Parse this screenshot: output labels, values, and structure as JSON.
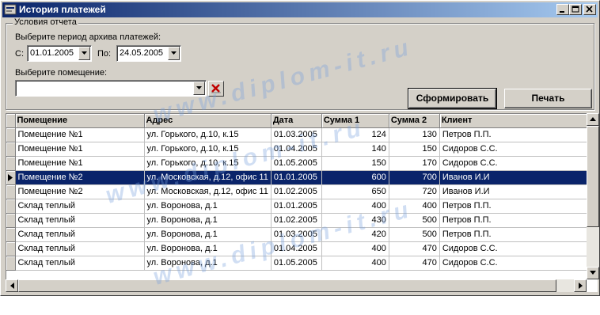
{
  "window": {
    "title": "История платежей"
  },
  "conditions": {
    "legend": "Условия отчета",
    "period_label": "Выберите период архива платежей:",
    "from_label": "С:",
    "from_value": "01.01.2005",
    "to_label": "По:",
    "to_value": "24.05.2005",
    "room_label": "Выберите помещение:",
    "room_value": ""
  },
  "actions": {
    "generate_label": "Сформировать",
    "print_label": "Печать"
  },
  "table": {
    "columns": [
      "Помещение",
      "Адрес",
      "Дата",
      "Сумма 1",
      "Сумма 2",
      "Клиент"
    ],
    "selected_row": 3,
    "rows": [
      [
        "Помещение №1",
        "ул. Горького, д.10, к.15",
        "01.03.2005",
        "124",
        "130",
        "Петров П.П."
      ],
      [
        "Помещение №1",
        "ул. Горького, д.10, к.15",
        "01.04.2005",
        "140",
        "150",
        "Сидоров С.С."
      ],
      [
        "Помещение №1",
        "ул. Горького, д.10, к.15",
        "01.05.2005",
        "150",
        "170",
        "Сидоров С.С."
      ],
      [
        "Помещение №2",
        "ул. Московская, д.12, офис 11",
        "01.01.2005",
        "600",
        "700",
        "Иванов И.И"
      ],
      [
        "Помещение №2",
        "ул. Московская, д.12, офис 11",
        "01.02.2005",
        "650",
        "720",
        "Иванов И.И"
      ],
      [
        "Склад теплый",
        "ул. Воронова, д.1",
        "01.01.2005",
        "400",
        "400",
        "Петров П.П."
      ],
      [
        "Склад теплый",
        "ул. Воронова, д.1",
        "01.02.2005",
        "430",
        "500",
        "Петров П.П."
      ],
      [
        "Склад теплый",
        "ул. Воронова, д.1",
        "01.03.2005",
        "420",
        "500",
        "Петров П.П."
      ],
      [
        "Склад теплый",
        "ул. Воронова, д.1",
        "01.04.2005",
        "400",
        "470",
        "Сидоров С.С."
      ],
      [
        "Склад теплый",
        "ул. Воронова, д.1",
        "01.05.2005",
        "400",
        "470",
        "Сидоров С.С."
      ]
    ]
  },
  "watermark": {
    "text": "www.diplom-it.ru",
    "color": "#78a0dc"
  },
  "colors": {
    "titlebar": "#0a246a",
    "selection": "#0a246a",
    "face": "#d4d0c8"
  }
}
